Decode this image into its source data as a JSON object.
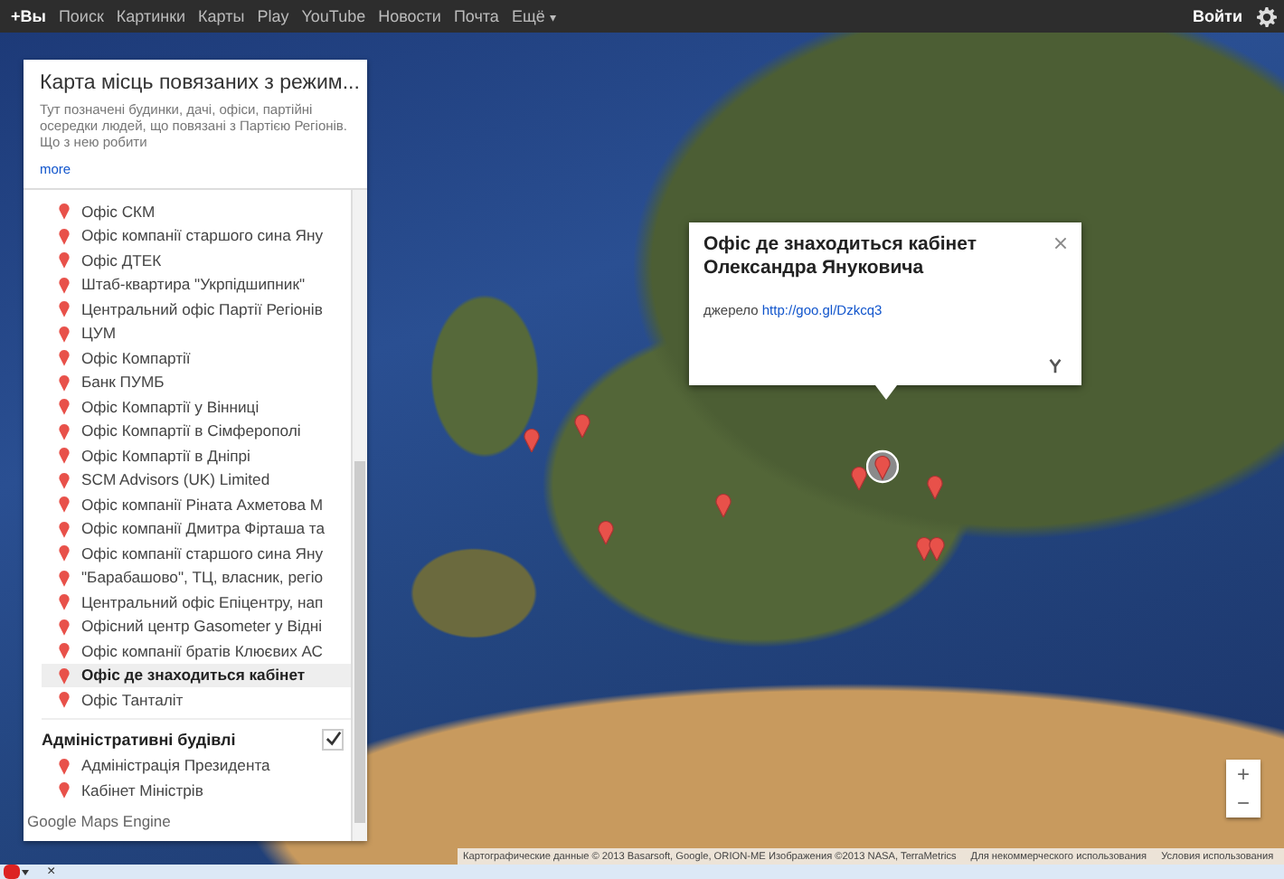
{
  "top_bar": {
    "links": [
      {
        "label": "+Вы",
        "selected": true
      },
      {
        "label": "Поиск",
        "selected": false
      },
      {
        "label": "Картинки",
        "selected": false
      },
      {
        "label": "Карты",
        "selected": false
      },
      {
        "label": "Play",
        "selected": false
      },
      {
        "label": "YouTube",
        "selected": false
      },
      {
        "label": "Новости",
        "selected": false
      },
      {
        "label": "Почта",
        "selected": false
      }
    ],
    "more": "Ещё",
    "more_caret": "▾",
    "sign_in": "Войти"
  },
  "panel": {
    "title": "Карта місць повязаних з режим...",
    "description": "Тут позначені будинки, дачі, офіси, партійні осередки людей, що повязані з Партією Регіонів. Що з нею робити",
    "more_link": "more",
    "layers": [
      {
        "items": [
          {
            "label": "Офіс СКМ",
            "selected": false
          },
          {
            "label": "Офіс компанії старшого сина Яну",
            "selected": false
          },
          {
            "label": "Офіс ДТЕК",
            "selected": false
          },
          {
            "label": "Штаб-квартира \"Укрпідшипник\"",
            "selected": false
          },
          {
            "label": "Центральний офіс Партії Регіонів",
            "selected": false
          },
          {
            "label": "ЦУМ",
            "selected": false
          },
          {
            "label": "Офіс Компартії",
            "selected": false
          },
          {
            "label": "Банк ПУМБ",
            "selected": false
          },
          {
            "label": "Офіс Компартії у Вінниці",
            "selected": false
          },
          {
            "label": "Офіс Компартії в Сімферополі",
            "selected": false
          },
          {
            "label": "Офіс Компартії в Дніпрі",
            "selected": false
          },
          {
            "label": "SCM Advisors (UK) Limited",
            "selected": false
          },
          {
            "label": "Офіс компанії Ріната Ахметова М",
            "selected": false
          },
          {
            "label": "Офіс компанії Дмитра Фірташа та",
            "selected": false
          },
          {
            "label": "Офіс компанії старшого сина Яну",
            "selected": false
          },
          {
            "label": "\"Барабашово\", ТЦ, власник, регіо",
            "selected": false
          },
          {
            "label": "Центральний офіс Епіцентру, нап",
            "selected": false
          },
          {
            "label": "Офісний центр Gasometer у Відні",
            "selected": false
          },
          {
            "label": "Офіс компанії братів Клюєвих АС",
            "selected": false
          },
          {
            "label": "Офіс де знаходиться кабінет",
            "selected": true
          },
          {
            "label": "Офіс Танталіт",
            "selected": false
          }
        ]
      },
      {
        "title": "Адміністративні будівлі",
        "checked": true,
        "items": [
          {
            "label": "Адміністрація Президента",
            "selected": false
          },
          {
            "label": "Кабінет Міністрів",
            "selected": false
          }
        ]
      }
    ]
  },
  "logo": "Google Maps Engine",
  "map": {
    "pins": [
      {
        "selected": false
      },
      {
        "selected": false
      },
      {
        "selected": false
      },
      {
        "selected": false
      },
      {
        "selected": true
      },
      {
        "selected": false
      },
      {
        "selected": false
      },
      {
        "selected": false
      },
      {
        "selected": false
      }
    ]
  },
  "popup": {
    "title": "Офіс де знаходиться кабінет Олександра Януковича",
    "source_label": "джерело",
    "link": "http://goo.gl/Dzkcq3"
  },
  "zoom": {
    "in": "+",
    "out": "−"
  },
  "attribution": [
    "Картографические данные © 2013 Basarsoft, Google, ORION-ME Изображения ©2013 NASA, TerraMetrics",
    "Для некоммерческого использования",
    "Условия использования"
  ],
  "bottom_bar": {
    "close": "×"
  }
}
